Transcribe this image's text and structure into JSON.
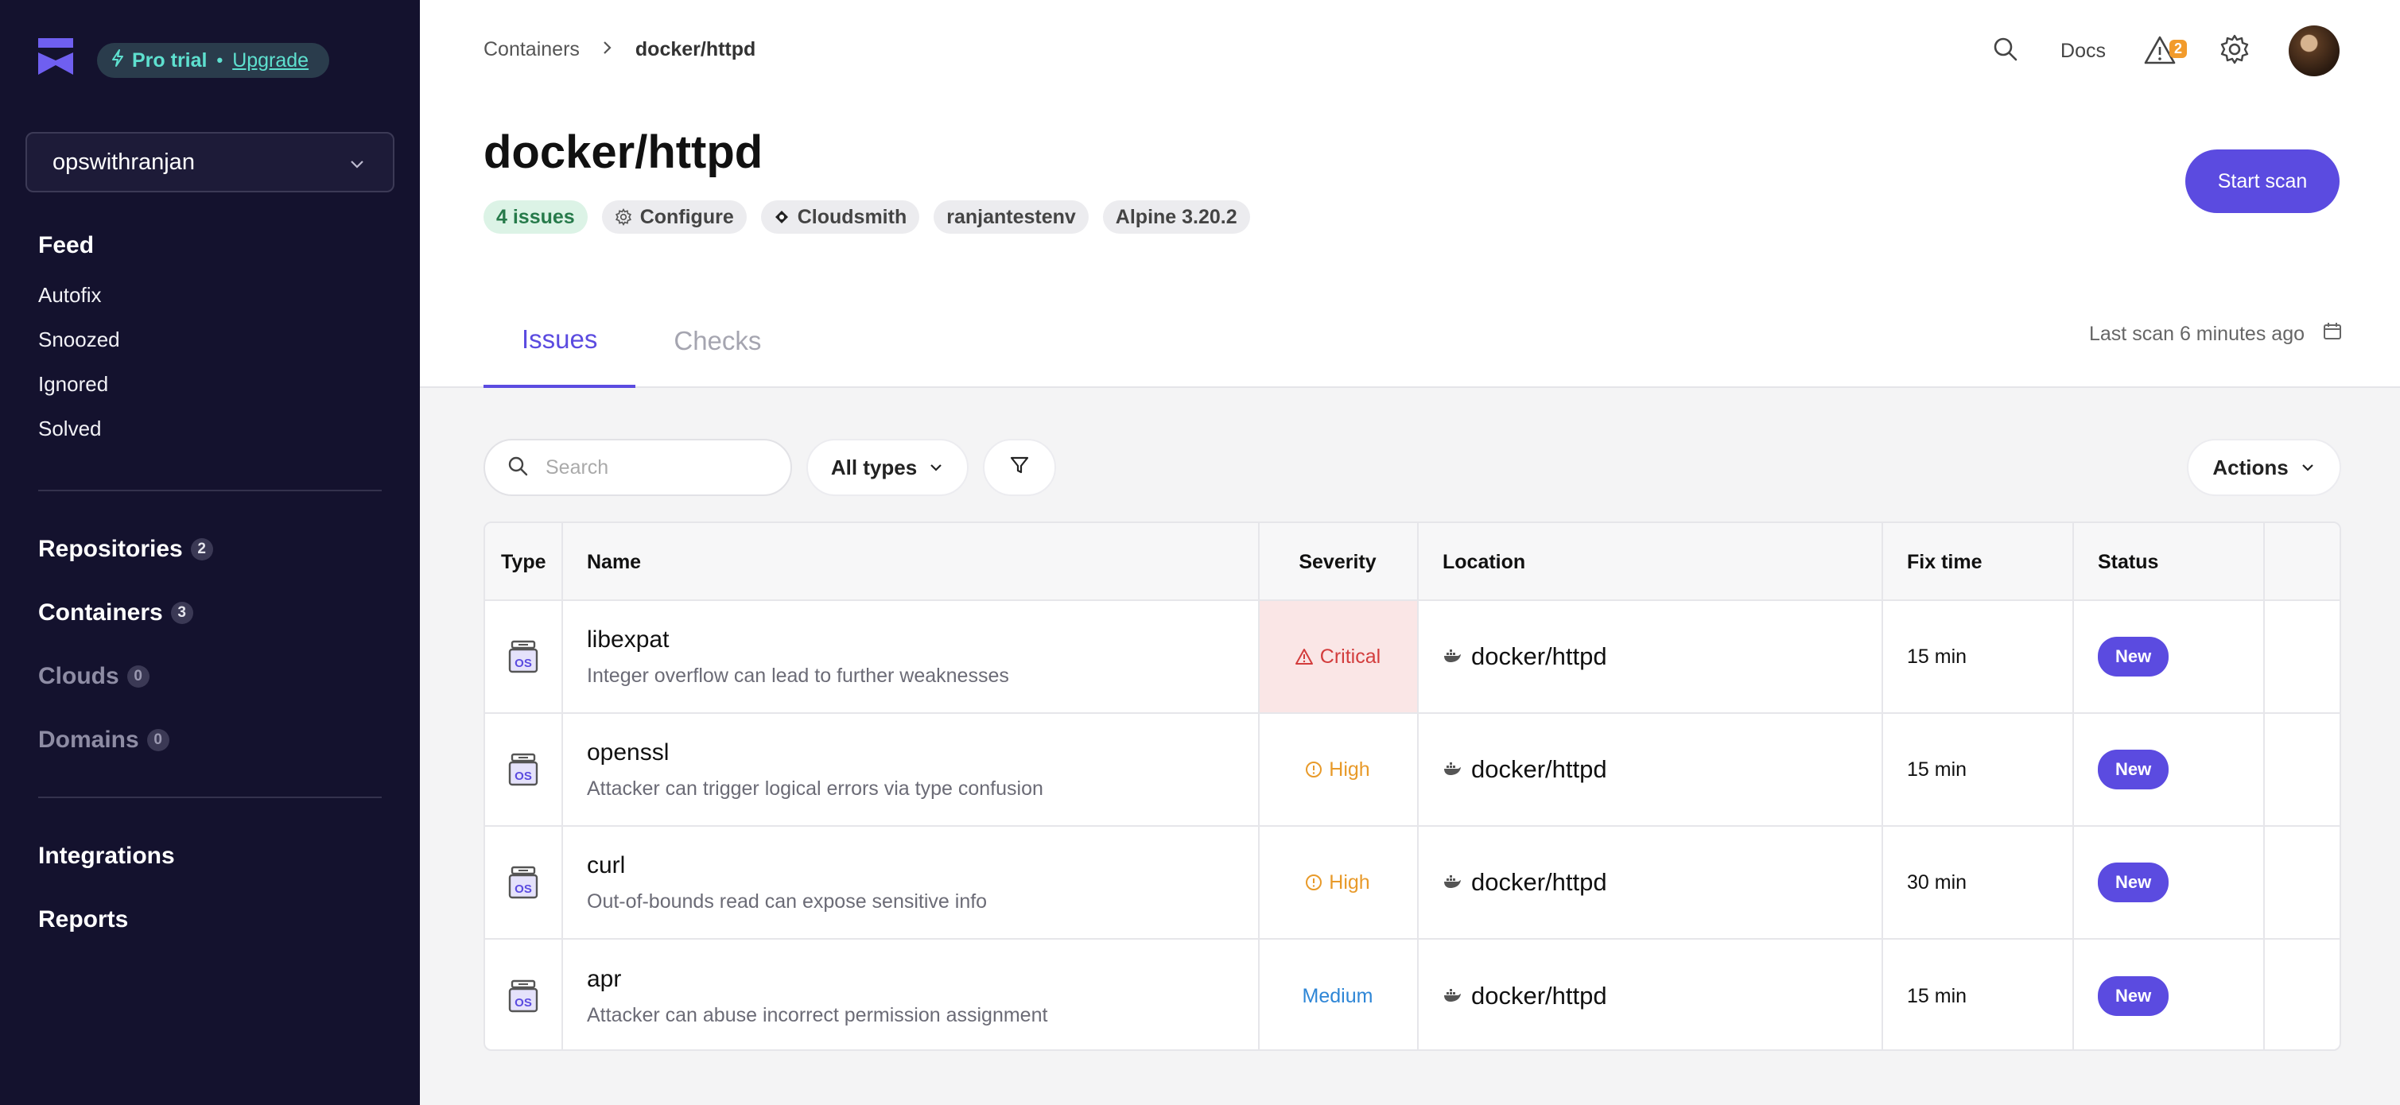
{
  "sidebar": {
    "trial_label": "Pro trial",
    "upgrade_label": "Upgrade",
    "org_name": "opswithranjan",
    "feed_label": "Feed",
    "feed_items": [
      "Autofix",
      "Snoozed",
      "Ignored",
      "Solved"
    ],
    "sections": [
      {
        "label": "Repositories",
        "count": "2"
      },
      {
        "label": "Containers",
        "count": "3"
      },
      {
        "label": "Clouds",
        "count": "0"
      },
      {
        "label": "Domains",
        "count": "0"
      }
    ],
    "integrations_label": "Integrations",
    "reports_label": "Reports"
  },
  "header": {
    "breadcrumb_root": "Containers",
    "breadcrumb_current": "docker/httpd",
    "docs_label": "Docs",
    "alerts_count": "2",
    "title": "docker/httpd",
    "tags": {
      "issues": "4 issues",
      "configure": "Configure",
      "registry": "Cloudsmith",
      "env": "ranjantestenv",
      "os": "Alpine 3.20.2"
    },
    "start_scan_label": "Start scan",
    "tabs": [
      "Issues",
      "Checks"
    ],
    "last_scan": "Last scan 6 minutes ago"
  },
  "toolbar": {
    "search_placeholder": "Search",
    "type_filter": "All types",
    "actions_label": "Actions"
  },
  "table": {
    "columns": [
      "Type",
      "Name",
      "Severity",
      "Location",
      "Fix time",
      "Status"
    ],
    "rows": [
      {
        "type": "OS",
        "name": "libexpat",
        "desc": "Integer overflow can lead to further weaknesses",
        "severity": "Critical",
        "location": "docker/httpd",
        "fix_time": "15 min",
        "status": "New"
      },
      {
        "type": "OS",
        "name": "openssl",
        "desc": "Attacker can trigger logical errors via type confusion",
        "severity": "High",
        "location": "docker/httpd",
        "fix_time": "15 min",
        "status": "New"
      },
      {
        "type": "OS",
        "name": "curl",
        "desc": "Out-of-bounds read can expose sensitive info",
        "severity": "High",
        "location": "docker/httpd",
        "fix_time": "30 min",
        "status": "New"
      },
      {
        "type": "OS",
        "name": "apr",
        "desc": "Attacker can abuse incorrect permission assignment",
        "severity": "Medium",
        "location": "docker/httpd",
        "fix_time": "15 min",
        "status": "New"
      }
    ]
  },
  "colors": {
    "sidebar_bg": "#14122e",
    "accent": "#5b4be0",
    "critical": "#d33d3d",
    "high": "#e89a2a",
    "medium": "#2e86d6",
    "trial_text": "#5ee0cf"
  }
}
